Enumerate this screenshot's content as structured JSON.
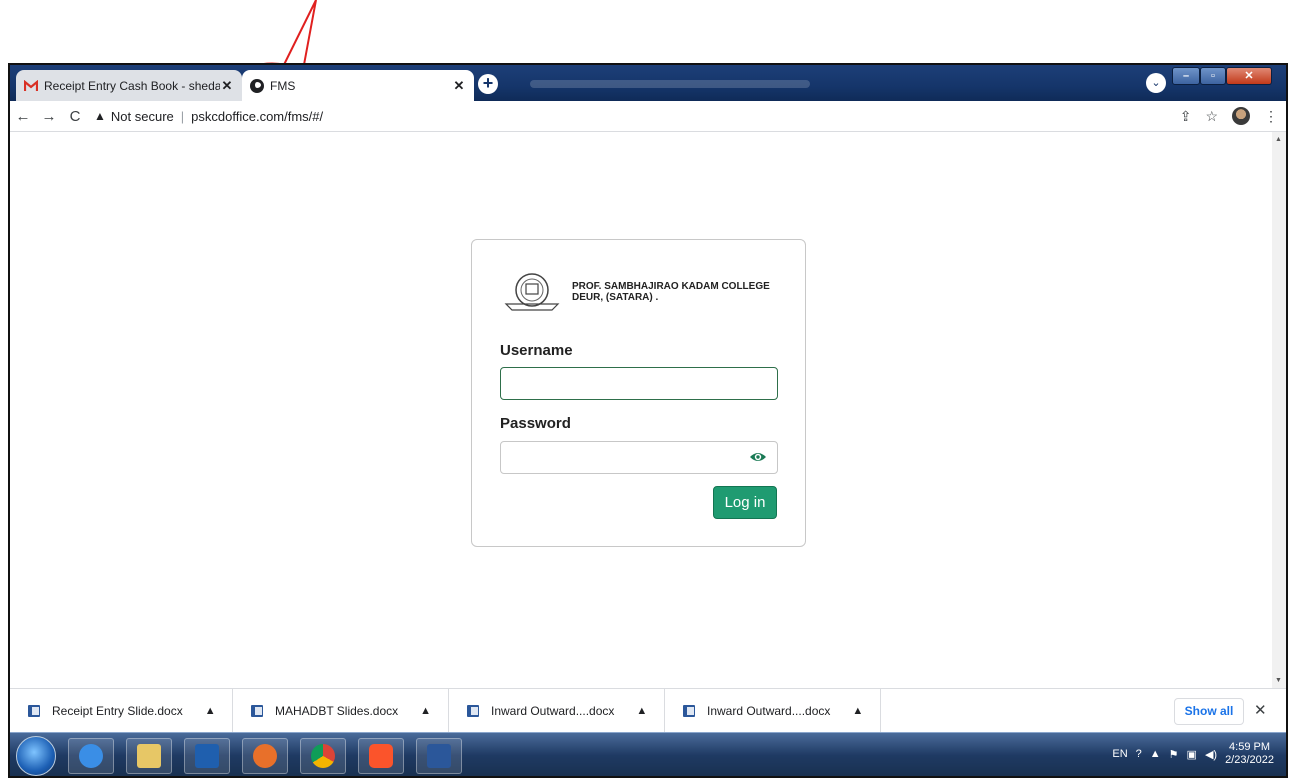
{
  "browser": {
    "tabs": [
      {
        "title": "Receipt Entry Cash Book - shedag",
        "icon": "gmail-icon",
        "close": "✕"
      },
      {
        "title": "FMS",
        "icon": "globe-icon",
        "close": "✕"
      }
    ],
    "new_tab": "+",
    "address": {
      "security_label": "Not secure",
      "url": "pskcdoffice.com/fms/#/"
    }
  },
  "login": {
    "college_name": "PROF. SAMBHAJIRAO KADAM COLLEGE DEUR, (SATARA) .",
    "username_label": "Username",
    "username_value": "",
    "password_label": "Password",
    "password_value": "",
    "login_button": "Log in",
    "accent_color": "#1f9b71"
  },
  "downloads": {
    "items": [
      {
        "name": "Receipt Entry Slide.docx"
      },
      {
        "name": "MAHADBT Slides.docx"
      },
      {
        "name": "Inward Outward....docx"
      },
      {
        "name": "Inward Outward....docx"
      }
    ],
    "show_all": "Show all"
  },
  "taskbar": {
    "language": "EN",
    "time": "4:59 PM",
    "date": "2/23/2022"
  },
  "annotation": {
    "color": "#e0201f"
  }
}
